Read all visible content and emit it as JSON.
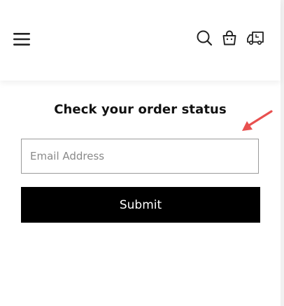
{
  "header": {
    "icons": [
      "hamburger-menu-icon",
      "search-icon",
      "shopping-bag-icon",
      "delivery-truck-icon"
    ]
  },
  "order_status": {
    "title": "Check your order status",
    "email_placeholder": "Email Address",
    "email_value": "",
    "submit_label": "Submit"
  },
  "colors": {
    "button_bg": "#000000",
    "button_text": "#ffffff",
    "annotation_arrow": "#e8504f",
    "input_border": "#9a9a9a"
  }
}
